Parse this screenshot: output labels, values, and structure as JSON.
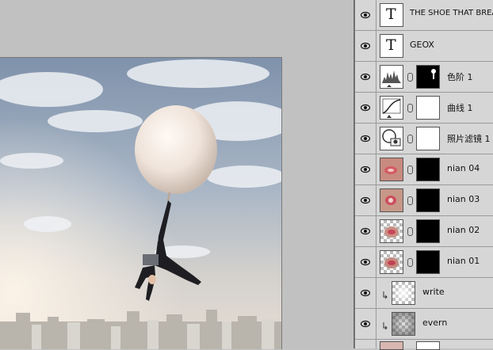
{
  "canvas": {
    "document_label": "document canvas"
  },
  "layers": [
    {
      "name": "THE SHOE THAT BREA",
      "kind": "text",
      "glyph": "T"
    },
    {
      "name": "GEOX",
      "kind": "text",
      "glyph": "T"
    },
    {
      "name": "色阶 1",
      "kind": "levels"
    },
    {
      "name": "曲线 1",
      "kind": "curves"
    },
    {
      "name": "照片滤镜 1",
      "kind": "photo-filter"
    },
    {
      "name": "nian 04",
      "kind": "image"
    },
    {
      "name": "nian 03",
      "kind": "image"
    },
    {
      "name": "nian 02",
      "kind": "image"
    },
    {
      "name": "nian 01",
      "kind": "image"
    },
    {
      "name": "write",
      "kind": "clipped"
    },
    {
      "name": "evern",
      "kind": "clipped"
    }
  ],
  "colors": {
    "panel_bg": "#d4d4d4",
    "row_border": "#9a9a9a",
    "canvas_bg": "#c1c1c1",
    "sky_top": "#8295ad"
  }
}
